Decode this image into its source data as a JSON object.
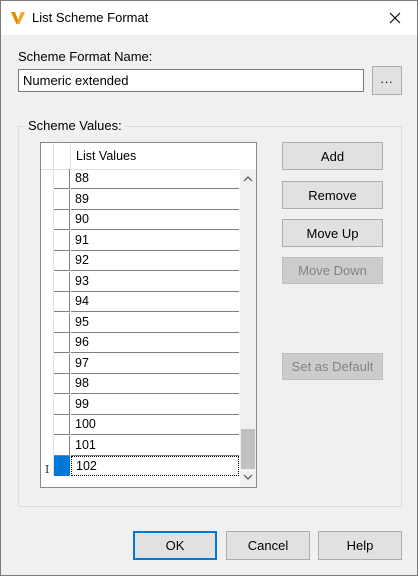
{
  "window": {
    "title": "List Scheme Format",
    "app_icon": "vault-v-icon",
    "close_glyph": "✕"
  },
  "form": {
    "name_label": "Scheme Format Name:",
    "name_value": "Numeric extended",
    "browse_label": "...",
    "group_label": "Scheme Values:"
  },
  "grid": {
    "header": "List Values",
    "rows": [
      "88",
      "89",
      "90",
      "91",
      "92",
      "93",
      "94",
      "95",
      "96",
      "97",
      "98",
      "99",
      "100",
      "101",
      "102"
    ],
    "selected_index": 14
  },
  "buttons": {
    "add": "Add",
    "remove": "Remove",
    "move_up": "Move Up",
    "move_down": "Move Down",
    "set_default": "Set as Default",
    "ok": "OK",
    "cancel": "Cancel",
    "help": "Help"
  },
  "colors": {
    "accent": "#0078d7",
    "icon_orange": "#f5a623"
  }
}
